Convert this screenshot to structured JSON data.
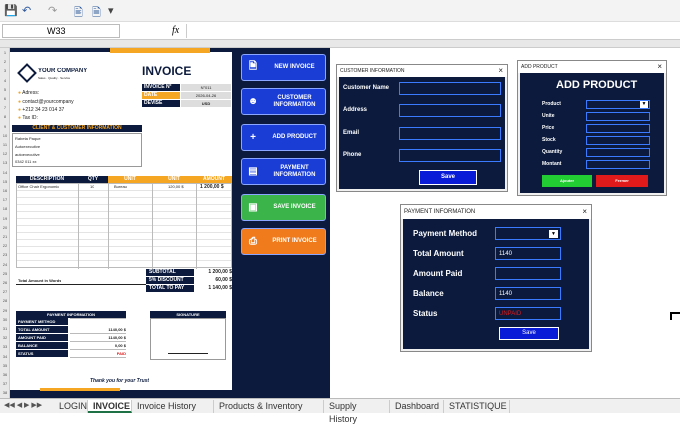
{
  "formula_bar": {
    "name_box": "W33",
    "fx": "fx"
  },
  "invoice": {
    "company": "YOUR COMPANY",
    "tagline": "Sales · Quality · Service",
    "title": "INVOICE",
    "invoice_no_label": "INVOICE N°",
    "invoice_no": "N°011",
    "date_label": "DATE",
    "date": "2026-04-26",
    "devise_label": "DEVISE",
    "devise": "USD",
    "address": "Adress:",
    "contact": "contact@yourcompany",
    "phone": "+212 34 23 014 37",
    "tax": "Tax ID:",
    "client_header": "CLIENT & CUSTOMER INFORMATION",
    "client_lines": [
      "Rabeta Paque",
      "Autoexecutive",
      "autoexecutive",
      "0342 011 xx"
    ],
    "columns": [
      "DESCRIPTION",
      "QTY",
      "UNIT",
      "UNIT",
      "AMOUNT"
    ],
    "item": {
      "desc": "Office Chair Ergonomic",
      "qty": "10",
      "unit": "Bureau",
      "price": "120,00 $",
      "amount": "1 200,00 $"
    },
    "words_label": "Total Amount in Words",
    "subtotal_label": "SUBTOTAL",
    "subtotal": "1 200,00 $",
    "discount_label": "5% DISCOUNT",
    "discount": "60,00 $",
    "total_label": "TOTAL TO PAY",
    "total": "1 140,00 $",
    "payment_header": "PAYMENT INFORMATION",
    "signature_header": "SIGNATURE",
    "pay_rows": [
      {
        "label": "PAYMENT METHOD",
        "value": ""
      },
      {
        "label": "TOTAL AMOUNT",
        "value": "1140,00 $"
      },
      {
        "label": "AMOUNT PAID",
        "value": "1140,00 $"
      },
      {
        "label": "BALANCE",
        "value": "0,00 $"
      },
      {
        "label": "STATUS",
        "value": "PAID"
      }
    ],
    "thanks": "Thank you for your Trust"
  },
  "panel_buttons": [
    {
      "label": "NEW INVOICE",
      "icon": "document-icon",
      "color": "#1a3dd6"
    },
    {
      "label": "CUSTOMER INFORMATION",
      "icon": "user-icon",
      "color": "#1a3dd6"
    },
    {
      "label": "ADD PRODUCT",
      "icon": "plus-icon",
      "color": "#1a3dd6"
    },
    {
      "label": "PAYMENT INFORMATION",
      "icon": "card-icon",
      "color": "#1a3dd6"
    },
    {
      "label": "SAVE INVOICE",
      "icon": "save-icon",
      "color": "#3bb54a"
    },
    {
      "label": "PRINT INVOICE",
      "icon": "print-icon",
      "color": "#f07b1d"
    }
  ],
  "customer_dialog": {
    "title": "CUSTOMER INFORMATION",
    "fields": [
      "Customer Name",
      "Address",
      "Email",
      "Phone"
    ],
    "save": "Save"
  },
  "product_dialog": {
    "title": "ADD PRODUCT",
    "heading": "ADD PRODUCT",
    "fields": [
      "Product",
      "Unite",
      "Price",
      "Stock",
      "Quantity",
      "Montant"
    ],
    "ajouter": "Ajouter",
    "fermer": "Fermer"
  },
  "payment_dialog": {
    "title": "PAYMENT  INFORMATION",
    "fields": [
      {
        "label": "Payment Method",
        "value": ""
      },
      {
        "label": "Total Amount",
        "value": "1140"
      },
      {
        "label": "Amount Paid",
        "value": ""
      },
      {
        "label": "Balance",
        "value": "1140"
      },
      {
        "label": "Status",
        "value": "UNPAID"
      }
    ],
    "save": "Save"
  },
  "tabs": [
    "LOGIN",
    "INVOICE",
    "Invoice History",
    "Products & Inventory",
    "Supply History",
    "Dashboard",
    "STATISTIQUE"
  ],
  "active_tab": "INVOICE"
}
